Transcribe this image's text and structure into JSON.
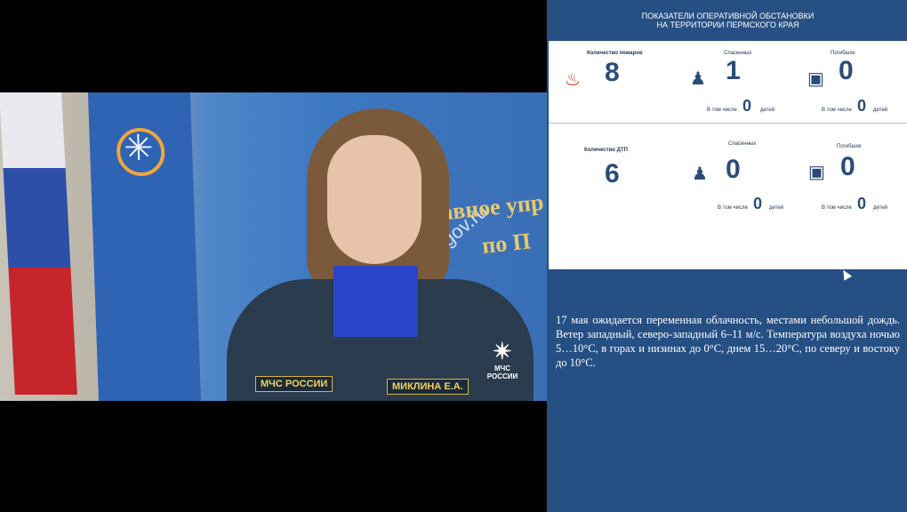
{
  "video": {
    "wall_text_line1": "Главное упр",
    "wall_text_line2": "по П",
    "wall_url": "ru.gov.ru",
    "chest_badge": "МЧС РОССИИ",
    "name_badge": "МИКЛИНА Е.А.",
    "logo_text": "МЧС РОССИИ"
  },
  "panel": {
    "title_line1": "ПОКАЗАТЕЛИ ОПЕРАТИВНОЙ ОБСТАНОВКИ",
    "title_line2": "НА ТЕРРИТОРИИ ПЕРМСКОГО КРАЯ",
    "fires": {
      "label": "Количество пожаров",
      "value": "8",
      "rescued_label": "Спасенных",
      "rescued": "1",
      "died_label": "Погибших",
      "died": "0",
      "incl_label": "В том числе",
      "incl_unit": "детей",
      "rescued_children": "0",
      "died_children": "0"
    },
    "dtp": {
      "label": "Количество ДТП",
      "value": "6",
      "rescued_label": "Спасенных",
      "rescued": "0",
      "died_label": "Погибших",
      "died": "0",
      "incl_label": "В том числе",
      "incl_unit": "детей",
      "rescued_children": "0",
      "died_children": "0"
    },
    "weather": "17 мая ожидается переменная облачность, местами небольшой дождь. Ветер западный, северо-западный 6–11 м/с. Температура воздуха ночью 5…10°С, в горах и низинах до 0°С, днем 15…20°С, по северу и востоку до 10°С."
  },
  "icons": {
    "fire": "fire-icon",
    "rescuer": "rescuer-icon",
    "died": "door-exit-icon"
  },
  "colors": {
    "panel_blue": "#264f84",
    "number_blue": "#2b4b78",
    "fire_red": "#d9261c"
  }
}
